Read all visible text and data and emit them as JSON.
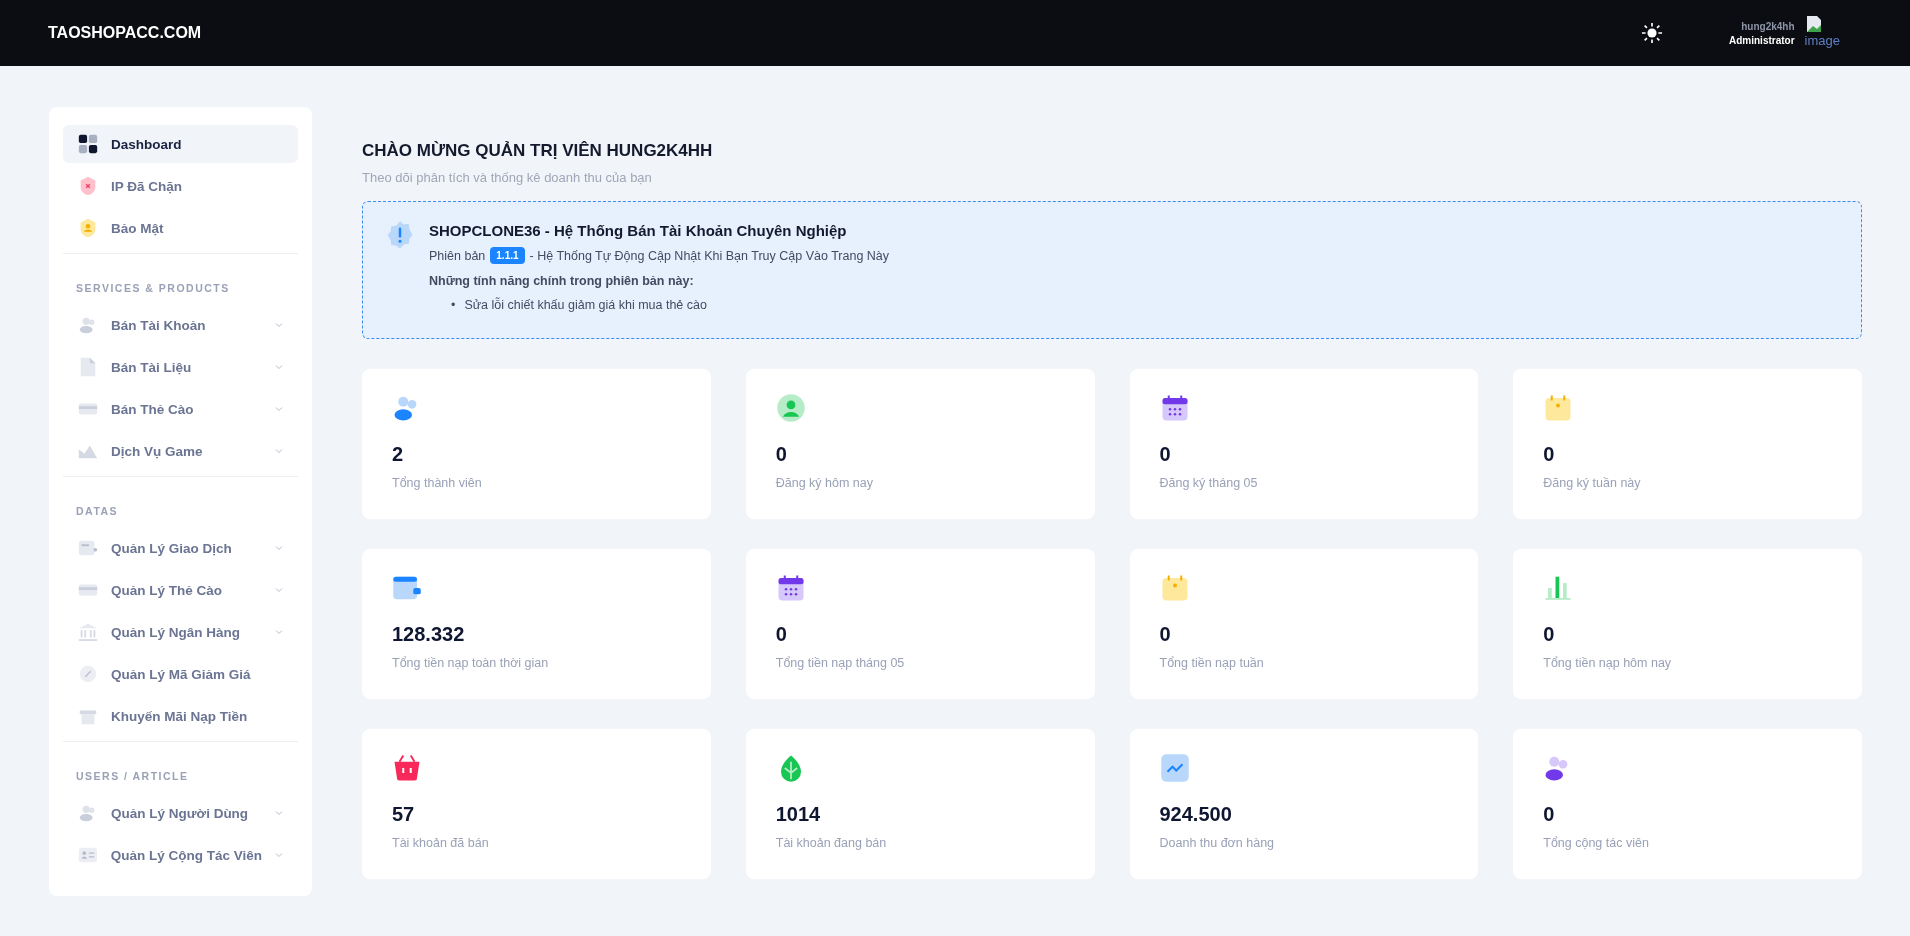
{
  "header": {
    "logo": "TAOSHOPACC.COM",
    "user": {
      "name": "hung2k4hh",
      "role": "Administrator",
      "avatar_alt": "image"
    }
  },
  "sidebar": {
    "top_items": [
      {
        "label": "Dashboard",
        "selected": true
      },
      {
        "label": "IP Đã Chặn",
        "selected": false
      },
      {
        "label": "Bảo Mật",
        "selected": false
      }
    ],
    "sections": [
      {
        "title": "SERVICES & PRODUCTS",
        "items": [
          {
            "label": "Bán Tài Khoản",
            "expandable": true
          },
          {
            "label": "Bán Tài Liệu",
            "expandable": true
          },
          {
            "label": "Bán Thẻ Cào",
            "expandable": true
          },
          {
            "label": "Dịch Vụ Game",
            "expandable": true
          }
        ]
      },
      {
        "title": "DATAS",
        "items": [
          {
            "label": "Quản Lý Giao Dịch",
            "expandable": true
          },
          {
            "label": "Quản Lý Thẻ Cào",
            "expandable": true
          },
          {
            "label": "Quản Lý Ngân Hàng",
            "expandable": true
          },
          {
            "label": "Quản Lý Mã Giảm Giá",
            "expandable": false
          },
          {
            "label": "Khuyến Mãi Nạp Tiền",
            "expandable": false
          }
        ]
      },
      {
        "title": "USERS / ARTICLE",
        "items": [
          {
            "label": "Quản Lý Người Dùng",
            "expandable": true
          },
          {
            "label": "Quản Lý Cộng Tác Viên",
            "expandable": true
          }
        ]
      }
    ]
  },
  "page": {
    "title": "CHÀO MỪNG QUẢN TRỊ VIÊN HUNG2K4HH",
    "subtitle": "Theo dõi phân tích và thống kê doanh thu của bạn"
  },
  "notice": {
    "title": "SHOPCLONE36 - Hệ Thống Bán Tài Khoản Chuyên Nghiệp",
    "version_prefix": "Phiên bản",
    "version": "1.1.1",
    "version_suffix": "- Hệ Thống Tự Động Cập Nhật Khi Bạn Truy Cập Vào Trang Này",
    "features_title": "Những tính năng chính trong phiên bản này:",
    "features": [
      {
        "bullet": "•",
        "text": "Sửa lỗi chiết khấu giảm giá khi mua thẻ cào"
      }
    ]
  },
  "stats": [
    {
      "value": "2",
      "label": "Tổng thành viên"
    },
    {
      "value": "0",
      "label": "Đăng ký hôm nay"
    },
    {
      "value": "0",
      "label": "Đăng ký tháng 05"
    },
    {
      "value": "0",
      "label": "Đăng ký tuần này"
    },
    {
      "value": "128.332",
      "label": "Tổng tiền nạp toàn thời gian"
    },
    {
      "value": "0",
      "label": "Tổng tiền nạp tháng 05"
    },
    {
      "value": "0",
      "label": "Tổng tiền nạp tuần"
    },
    {
      "value": "0",
      "label": "Tổng tiền nạp hôm nay"
    },
    {
      "value": "57",
      "label": "Tài khoản đã bán"
    },
    {
      "value": "1014",
      "label": "Tài khoản đang bán"
    },
    {
      "value": "924.500",
      "label": "Doanh thu đơn hàng"
    },
    {
      "value": "0",
      "label": "Tổng cộng tác viên"
    }
  ]
}
